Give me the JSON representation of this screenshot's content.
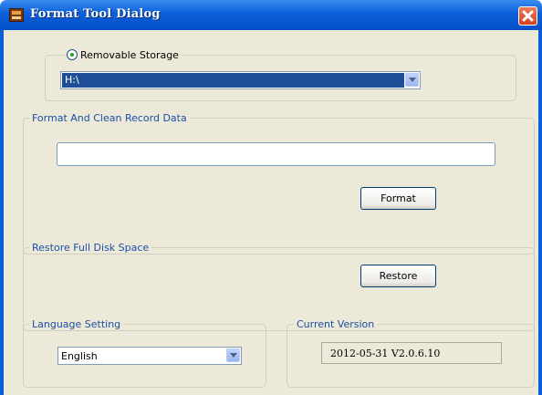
{
  "window": {
    "title": "Format Tool Dialog"
  },
  "storage": {
    "radio_label": "Removable Storage",
    "drive_value": "H:\\",
    "selected": true
  },
  "format_group": {
    "legend": "Format And Clean Record Data",
    "input_value": "",
    "button_label": "Format"
  },
  "restore_group": {
    "legend": "Restore Full Disk Space",
    "button_label": "Restore"
  },
  "language_group": {
    "legend": "Language Setting",
    "selected_language": "English"
  },
  "version_group": {
    "legend": "Current Version",
    "version": "2012-05-31 V2.0.6.10"
  },
  "colors": {
    "titlebar": "#0a5fd8",
    "dialog_bg": "#ece9d8",
    "legend_text": "#1a4fa8",
    "selection": "#1f4e99"
  }
}
